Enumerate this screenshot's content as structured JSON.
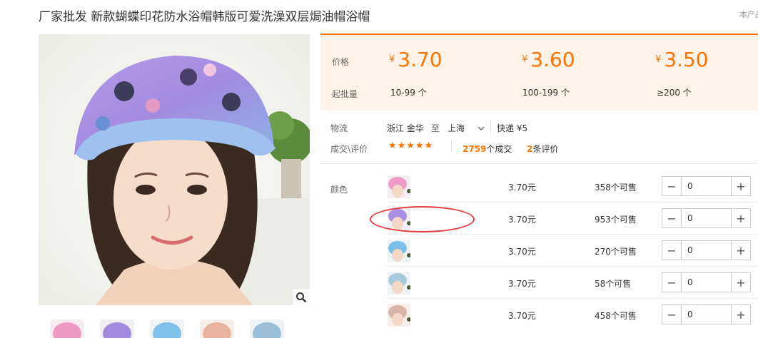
{
  "product": {
    "title": "厂家批发 新款蝴蝶印花防水浴帽韩版可爱洗澡双层焗油帽浴帽",
    "corner_link": "本产品"
  },
  "pricing": {
    "price_label": "价格",
    "moq_label": "起批量",
    "currency": "¥",
    "tiers": [
      {
        "price": "3.70",
        "range": "10-99 个"
      },
      {
        "price": "3.60",
        "range": "100-199 个"
      },
      {
        "price": "3.50",
        "range": "≥200 个"
      }
    ]
  },
  "logistics": {
    "label": "物流",
    "from": "浙江 金华",
    "to_word": "至",
    "to": "上海",
    "express": "快递 ¥5"
  },
  "reviews": {
    "label": "成交\\评价",
    "stars": "★★★★★",
    "deals_count": "2759",
    "deals_suffix": "个成交",
    "review_count": "2",
    "review_suffix": "条评价"
  },
  "sku": {
    "label": "颜色",
    "items": [
      {
        "price": "3.70元",
        "stock": "358个可售",
        "qty": "0"
      },
      {
        "price": "3.70元",
        "stock": "953个可售",
        "qty": "0"
      },
      {
        "price": "3.70元",
        "stock": "270个可售",
        "qty": "0"
      },
      {
        "price": "3.70元",
        "stock": "58个可售",
        "qty": "0"
      },
      {
        "price": "3.70元",
        "stock": "458个可售",
        "qty": "0"
      }
    ],
    "minus": "−",
    "plus": "+"
  },
  "colors": {
    "accent": "#ff7300",
    "price_panel_bg": "#fff2e8",
    "annotation": "#e83b3b"
  },
  "icons": [
    "zoom-icon",
    "chevron-down-icon",
    "star-icon",
    "minus-icon",
    "plus-icon"
  ]
}
